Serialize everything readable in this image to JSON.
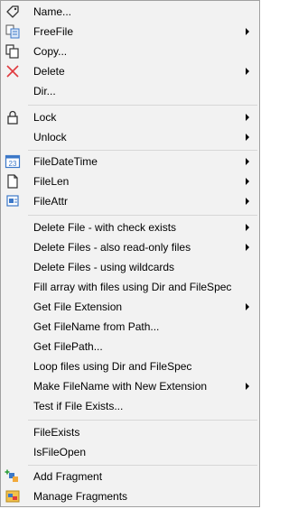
{
  "menu": {
    "items": [
      {
        "id": "name",
        "label": "Name...",
        "icon": "tag-icon",
        "submenu": false
      },
      {
        "id": "freefile",
        "label": "FreeFile",
        "icon": "copy-file-icon",
        "submenu": true
      },
      {
        "id": "copy",
        "label": "Copy...",
        "icon": "copy-icon",
        "submenu": false
      },
      {
        "id": "delete",
        "label": "Delete",
        "icon": "delete-x-icon",
        "submenu": true
      },
      {
        "id": "dir",
        "label": "Dir...",
        "icon": "",
        "submenu": false
      },
      {
        "id": "lock",
        "label": "Lock",
        "icon": "lock-icon",
        "submenu": true
      },
      {
        "id": "unlock",
        "label": "Unlock",
        "icon": "",
        "submenu": true
      },
      {
        "id": "filedatetime",
        "label": "FileDateTime",
        "icon": "calendar-icon",
        "submenu": true
      },
      {
        "id": "filelen",
        "label": "FileLen",
        "icon": "document-icon",
        "submenu": true
      },
      {
        "id": "fileattr",
        "label": "FileAttr",
        "icon": "file-attributes-icon",
        "submenu": true
      },
      {
        "id": "delete-check",
        "label": "Delete File - with check exists",
        "icon": "",
        "submenu": true
      },
      {
        "id": "delete-readonly",
        "label": "Delete Files - also read-only files",
        "icon": "",
        "submenu": true
      },
      {
        "id": "delete-wildcards",
        "label": "Delete Files - using wildcards",
        "icon": "",
        "submenu": false
      },
      {
        "id": "fill-array",
        "label": "Fill array with files using Dir and FileSpec",
        "icon": "",
        "submenu": false
      },
      {
        "id": "get-ext",
        "label": "Get File Extension",
        "icon": "",
        "submenu": true
      },
      {
        "id": "get-filename",
        "label": "Get FileName from Path...",
        "icon": "",
        "submenu": false
      },
      {
        "id": "get-filepath",
        "label": "Get FilePath...",
        "icon": "",
        "submenu": false
      },
      {
        "id": "loop-files",
        "label": "Loop files using Dir and FileSpec",
        "icon": "",
        "submenu": false
      },
      {
        "id": "make-filename",
        "label": "Make FileName with New Extension",
        "icon": "",
        "submenu": true
      },
      {
        "id": "test-exists",
        "label": "Test if File Exists...",
        "icon": "",
        "submenu": false
      },
      {
        "id": "fileexists",
        "label": "FileExists",
        "icon": "",
        "submenu": false
      },
      {
        "id": "isfileopen",
        "label": "IsFileOpen",
        "icon": "",
        "submenu": false
      },
      {
        "id": "add-fragment",
        "label": "Add Fragment",
        "icon": "add-fragment-icon",
        "submenu": false
      },
      {
        "id": "manage-fragments",
        "label": "Manage Fragments",
        "icon": "manage-fragments-icon",
        "submenu": false
      }
    ],
    "calendar_icon_text": "23",
    "colors": {
      "background": "#f2f2f2",
      "separator": "#d7d7d7",
      "delete_icon": "#e0393e",
      "accent_blue": "#3c78c8"
    }
  }
}
